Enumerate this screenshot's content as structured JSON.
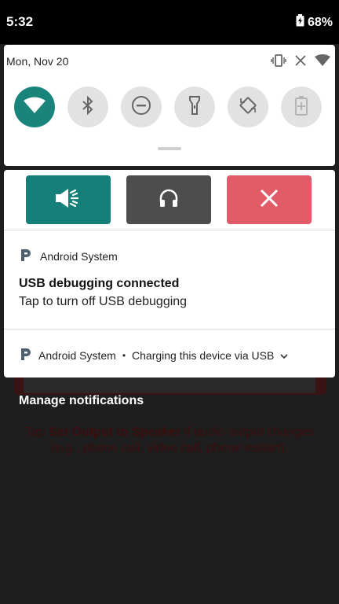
{
  "status_bar": {
    "time": "5:32",
    "battery_percent": "68%"
  },
  "quick_settings": {
    "date": "Mon, Nov 20",
    "tiles": [
      {
        "name": "wifi",
        "active": true
      },
      {
        "name": "bluetooth",
        "active": false
      },
      {
        "name": "do-not-disturb",
        "active": false
      },
      {
        "name": "flashlight",
        "active": false
      },
      {
        "name": "auto-rotate",
        "active": false
      },
      {
        "name": "battery-saver",
        "active": false
      }
    ]
  },
  "media_actions": {
    "speaker_icon": "speaker-icon",
    "headphones_icon": "headphones-icon",
    "close_icon": "close-icon",
    "colors": {
      "speaker": "#15807a",
      "headphones": "#4d4d4d",
      "close": "#e25b68"
    }
  },
  "notification": {
    "app_name": "Android System",
    "title": "USB debugging connected",
    "body": "Tap to turn off USB debugging"
  },
  "summary": {
    "app_name": "Android System",
    "separator": "•",
    "text": "Charging this device via USB"
  },
  "manage_label": "Manage notifications",
  "background_app": {
    "instruction_pre": "Tap ",
    "instruction_bold": "Set Output to Speaker",
    "instruction_post": " if audio output changes (e.g., phone call, video call, phone restart)."
  }
}
